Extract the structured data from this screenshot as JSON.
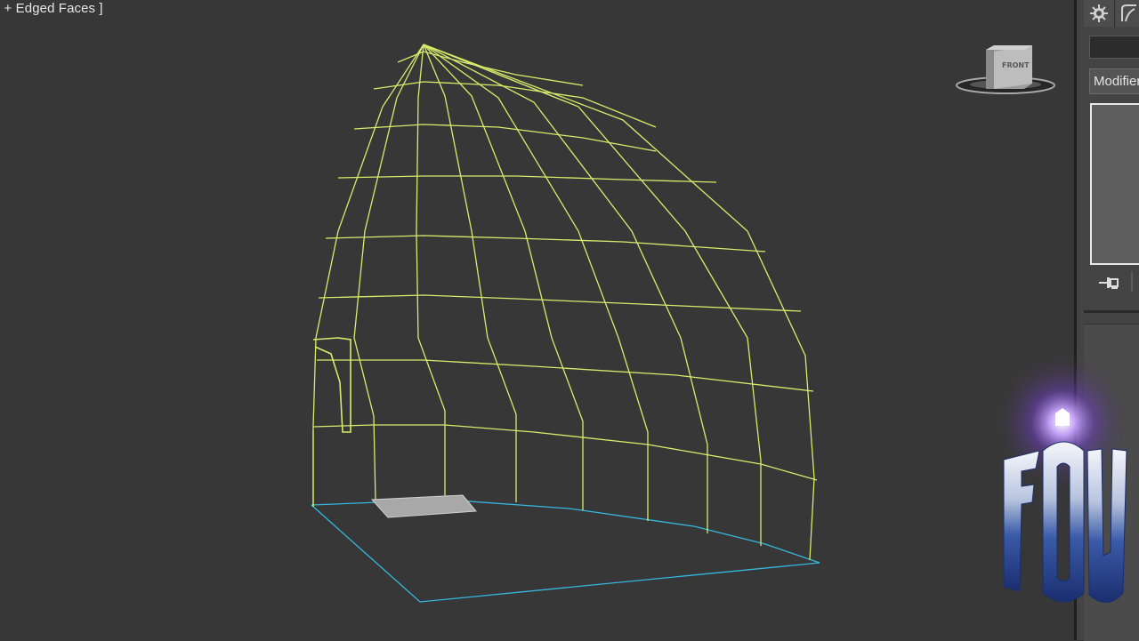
{
  "viewport": {
    "label": "[ + Edged Faces ]",
    "wire_color": "#d8ec6c",
    "grid_color": "#35b7e0",
    "background": "#373737"
  },
  "viewcube": {
    "face_label": "FRONT",
    "icon": "viewcube-icon"
  },
  "command_panel": {
    "tabs": [
      {
        "icon": "create-icon"
      },
      {
        "icon": "modify-icon"
      }
    ],
    "name_value": "",
    "modifier_list": "Modifier List",
    "pin_icon": "pin-stack-icon"
  },
  "watermark": {
    "text": "FOW",
    "icon": "fow-logo-icon"
  }
}
